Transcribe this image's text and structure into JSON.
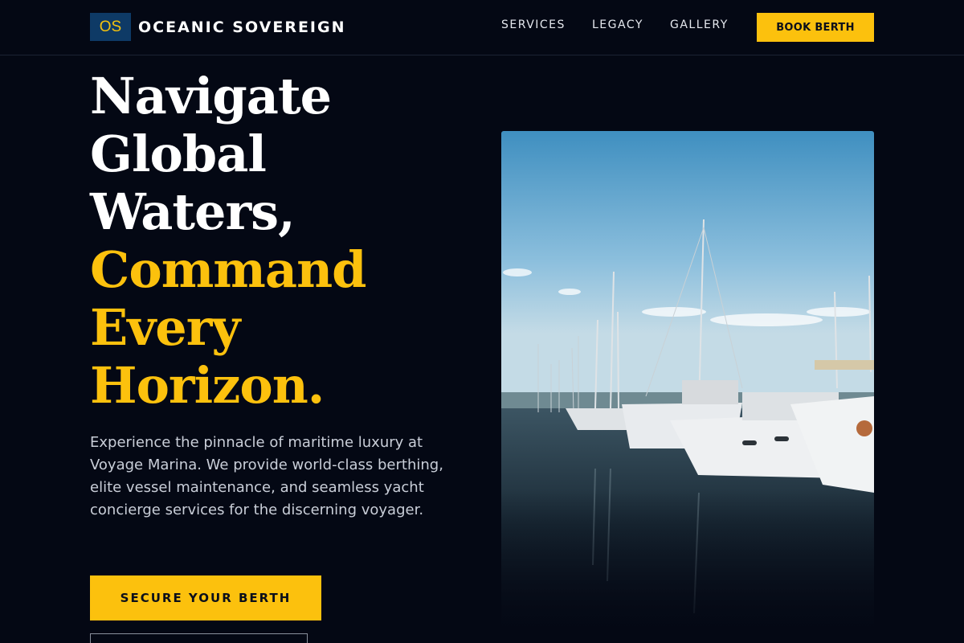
{
  "brand": {
    "badge": "OS",
    "name": "OCEANIC SOVEREIGN"
  },
  "nav": {
    "items": [
      {
        "label": "SERVICES"
      },
      {
        "label": "LEGACY"
      },
      {
        "label": "GALLERY"
      }
    ],
    "cta_label": "BOOK BERTH"
  },
  "hero": {
    "headline_white": [
      "Navigate",
      "Global",
      "Waters,"
    ],
    "headline_gold": [
      "Command",
      "Every",
      "Horizon."
    ],
    "description": "Experience the pinnacle of maritime luxury at Voyage Marina. We provide world-class berthing, elite vessel maintenance, and seamless yacht concierge services for the discerning voyager.",
    "primary_cta": "SECURE YOUR BERTH"
  },
  "image": {
    "subject": "marina with moored sailboats and motor yachts"
  },
  "colors": {
    "accent": "#fcc10d",
    "background": "#040814",
    "logo_badge": "#0e3a66"
  }
}
